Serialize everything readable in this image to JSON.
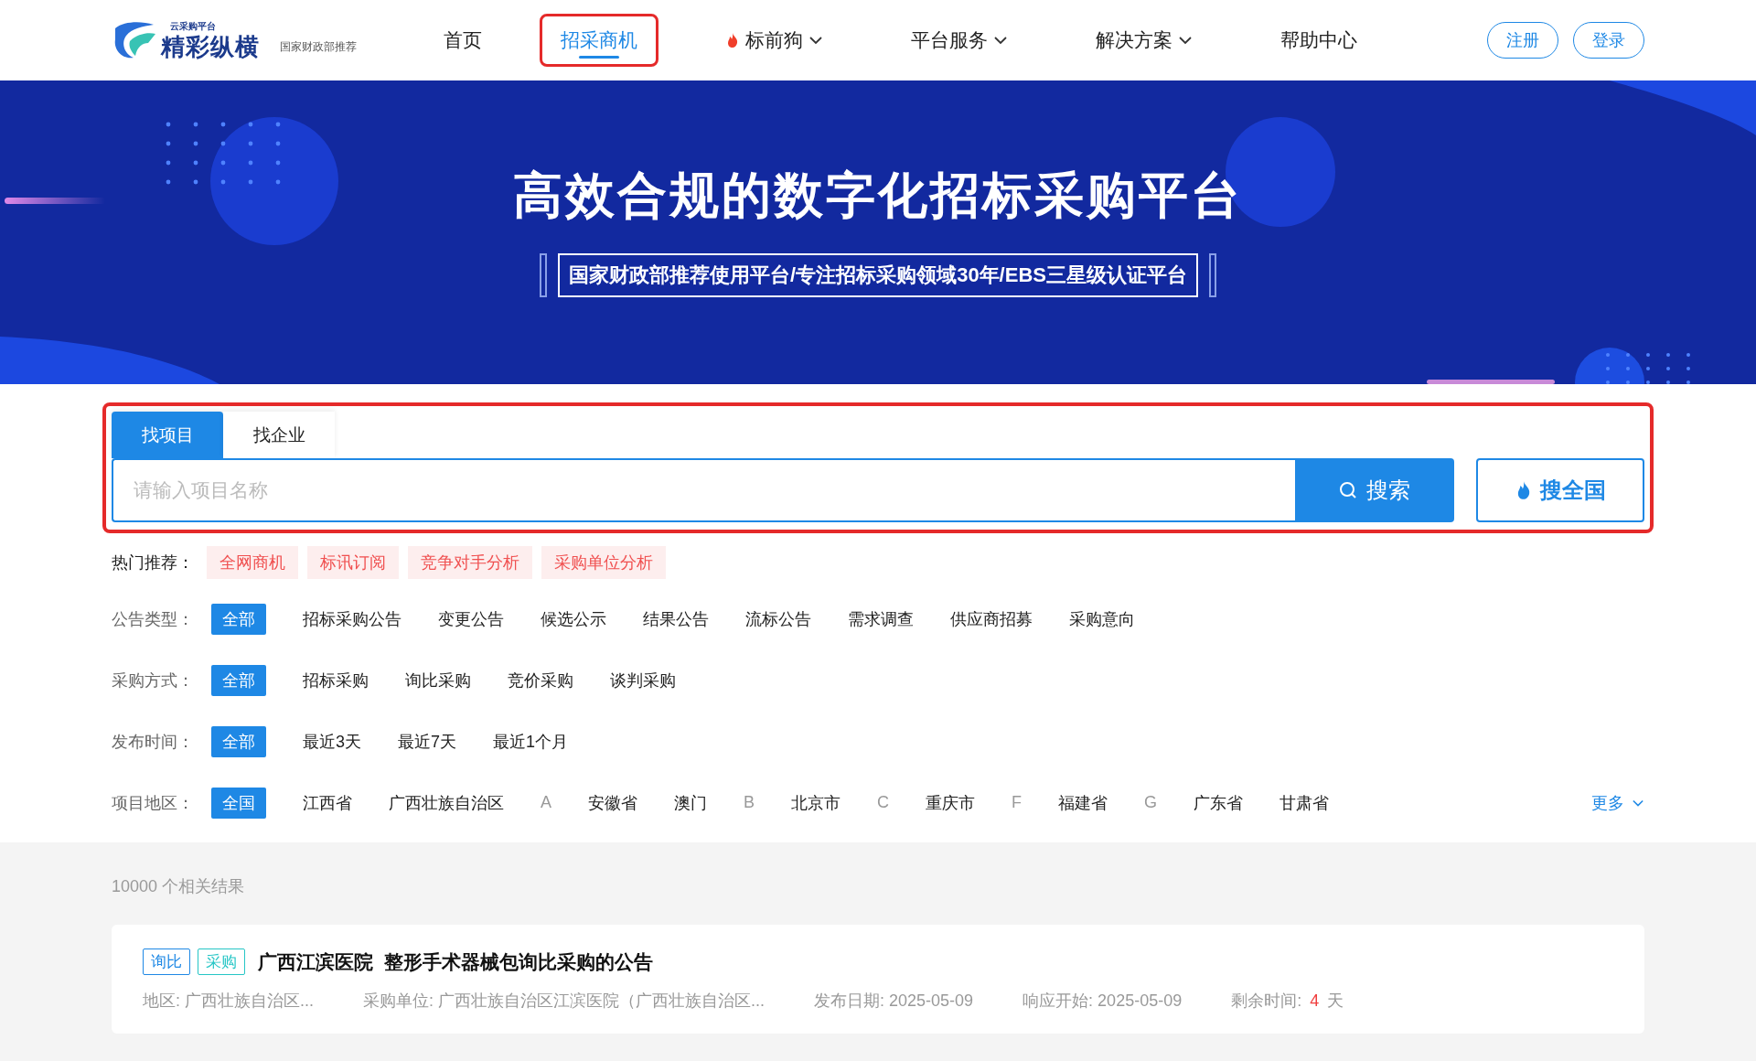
{
  "header": {
    "logo": {
      "small": "云采购平台",
      "name": "精彩纵横",
      "tagline": "国家财政部推荐"
    },
    "nav": [
      {
        "label": "首页",
        "selected": false,
        "highlighted": false,
        "hot": false,
        "dropdown": false
      },
      {
        "label": "招采商机",
        "selected": true,
        "highlighted": true,
        "hot": false,
        "dropdown": false
      },
      {
        "label": "标前狗",
        "selected": false,
        "highlighted": false,
        "hot": true,
        "dropdown": true
      },
      {
        "label": "平台服务",
        "selected": false,
        "highlighted": false,
        "hot": false,
        "dropdown": true
      },
      {
        "label": "解决方案",
        "selected": false,
        "highlighted": false,
        "hot": false,
        "dropdown": true
      },
      {
        "label": "帮助中心",
        "selected": false,
        "highlighted": false,
        "hot": false,
        "dropdown": false
      }
    ],
    "buttons": [
      "注册",
      "登录"
    ]
  },
  "banner": {
    "title": "高效合规的数字化招标采购平台",
    "subtitle": "国家财政部推荐使用平台/专注招标采购领域30年/EBS三星级认证平台"
  },
  "search": {
    "highlighted": true,
    "tabs": [
      {
        "label": "找项目",
        "selected": true
      },
      {
        "label": "找企业",
        "selected": false
      }
    ],
    "placeholder": "请输入项目名称",
    "search_button": "搜索",
    "nationwide_button": "搜全国"
  },
  "hot": {
    "label": "热门推荐：",
    "items": [
      "全网商机",
      "标讯订阅",
      "竞争对手分析",
      "采购单位分析"
    ]
  },
  "filters": [
    {
      "label": "公告类型：",
      "options": [
        {
          "label": "全部",
          "selected": true,
          "kind": "option"
        },
        {
          "label": "招标采购公告",
          "selected": false,
          "kind": "option"
        },
        {
          "label": "变更公告",
          "selected": false,
          "kind": "option"
        },
        {
          "label": "候选公示",
          "selected": false,
          "kind": "option"
        },
        {
          "label": "结果公告",
          "selected": false,
          "kind": "option"
        },
        {
          "label": "流标公告",
          "selected": false,
          "kind": "option"
        },
        {
          "label": "需求调查",
          "selected": false,
          "kind": "option"
        },
        {
          "label": "供应商招募",
          "selected": false,
          "kind": "option"
        },
        {
          "label": "采购意向",
          "selected": false,
          "kind": "option"
        }
      ]
    },
    {
      "label": "采购方式：",
      "options": [
        {
          "label": "全部",
          "selected": true,
          "kind": "option"
        },
        {
          "label": "招标采购",
          "selected": false,
          "kind": "option"
        },
        {
          "label": "询比采购",
          "selected": false,
          "kind": "option"
        },
        {
          "label": "竞价采购",
          "selected": false,
          "kind": "option"
        },
        {
          "label": "谈判采购",
          "selected": false,
          "kind": "option"
        }
      ]
    },
    {
      "label": "发布时间：",
      "options": [
        {
          "label": "全部",
          "selected": true,
          "kind": "option"
        },
        {
          "label": "最近3天",
          "selected": false,
          "kind": "option"
        },
        {
          "label": "最近7天",
          "selected": false,
          "kind": "option"
        },
        {
          "label": "最近1个月",
          "selected": false,
          "kind": "option"
        }
      ]
    },
    {
      "label": "项目地区：",
      "more": "更多",
      "options": [
        {
          "label": "全国",
          "selected": true,
          "kind": "option"
        },
        {
          "label": "江西省",
          "selected": false,
          "kind": "option"
        },
        {
          "label": "广西壮族自治区",
          "selected": false,
          "kind": "option"
        },
        {
          "label": "A",
          "kind": "letter"
        },
        {
          "label": "安徽省",
          "selected": false,
          "kind": "option"
        },
        {
          "label": "澳门",
          "selected": false,
          "kind": "option"
        },
        {
          "label": "B",
          "kind": "letter"
        },
        {
          "label": "北京市",
          "selected": false,
          "kind": "option"
        },
        {
          "label": "C",
          "kind": "letter"
        },
        {
          "label": "重庆市",
          "selected": false,
          "kind": "option"
        },
        {
          "label": "F",
          "kind": "letter"
        },
        {
          "label": "福建省",
          "selected": false,
          "kind": "option"
        },
        {
          "label": "G",
          "kind": "letter"
        },
        {
          "label": "广东省",
          "selected": false,
          "kind": "option"
        },
        {
          "label": "甘肃省",
          "selected": false,
          "kind": "option"
        }
      ]
    }
  ],
  "results": {
    "count": "10000 个相关结果",
    "items": [
      {
        "tags": [
          {
            "label": "询比",
            "color": "#1e88e5"
          },
          {
            "label": "采购",
            "color": "#26c6c6"
          }
        ],
        "title": "广西江滨医院  整形手术器械包询比采购的公告",
        "fields": [
          {
            "label": "地区:",
            "value": "广西壮族自治区..."
          },
          {
            "label": "采购单位:",
            "value": "广西壮族自治区江滨医院（广西壮族自治区..."
          },
          {
            "label": "发布日期:",
            "value": "2025-05-09"
          },
          {
            "label": "响应开始:",
            "value": "2025-05-09"
          }
        ],
        "remaining": {
          "label": "剩余时间:",
          "value": "4",
          "unit": "天"
        }
      }
    ]
  }
}
